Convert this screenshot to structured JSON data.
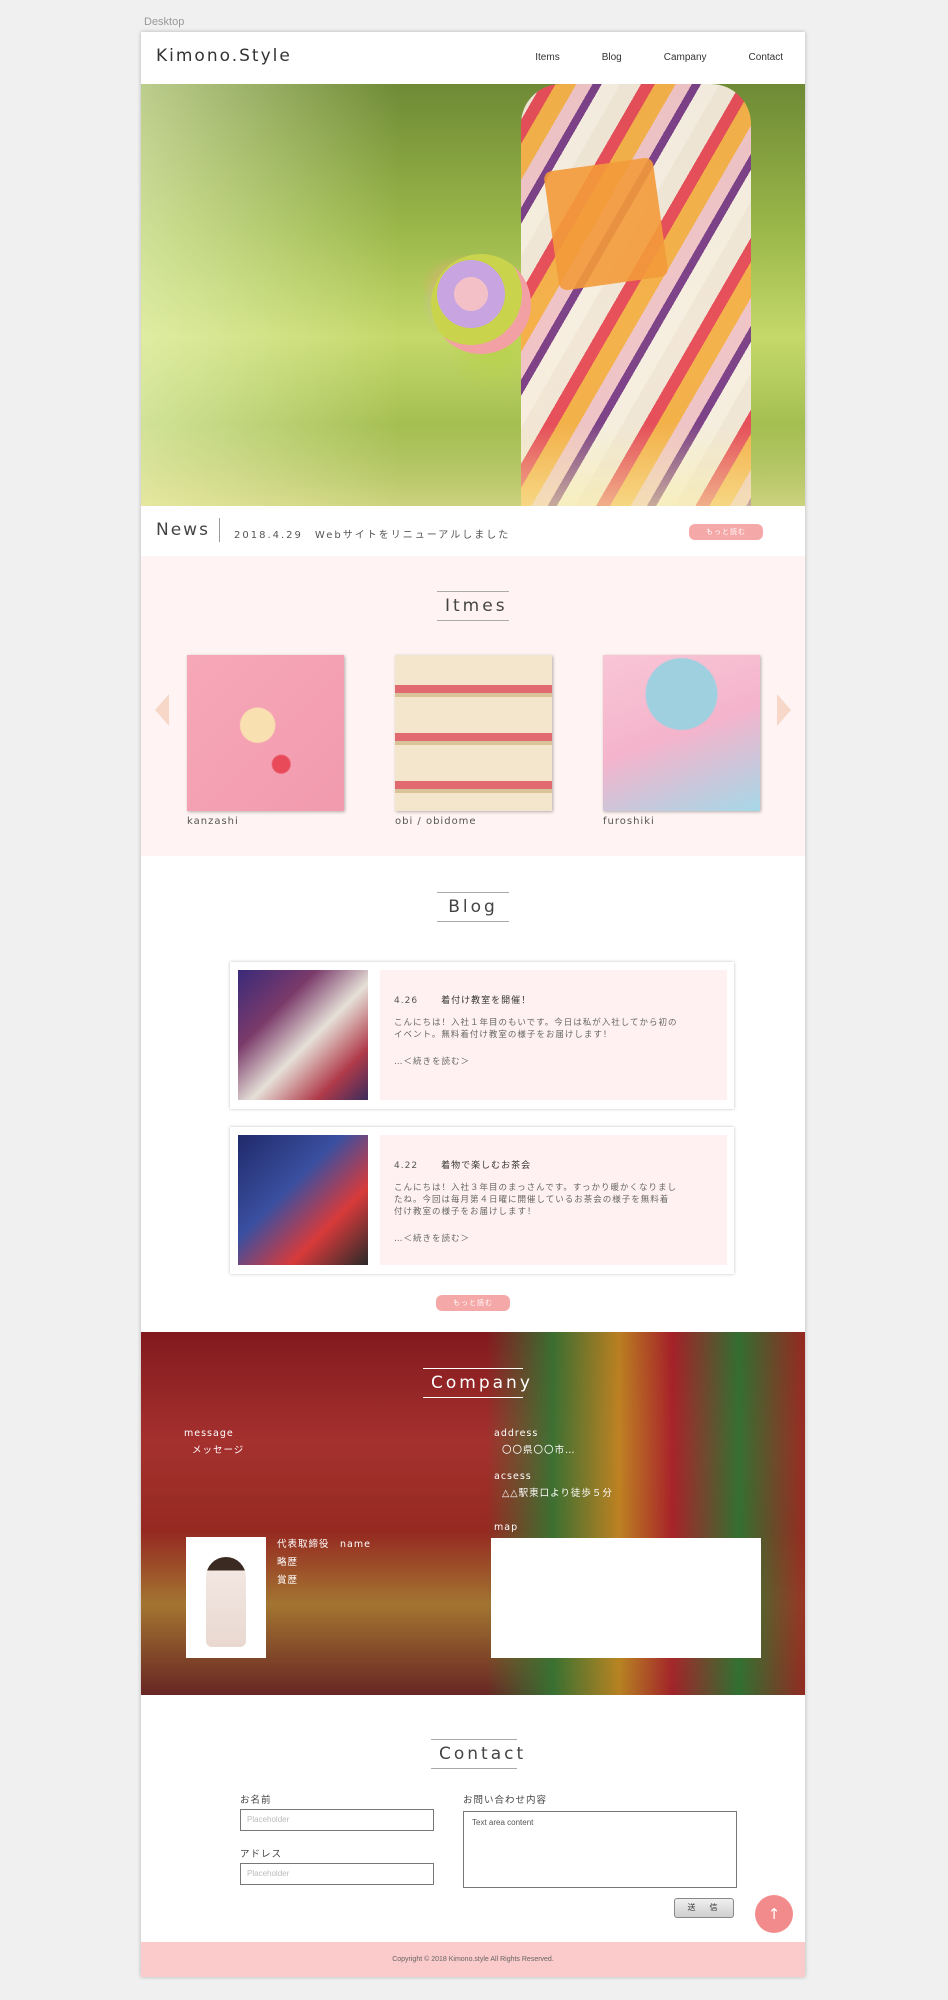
{
  "canvas": {
    "label": "Desktop"
  },
  "header": {
    "logo": "Kimono.Style",
    "nav": [
      "Items",
      "Blog",
      "Campany",
      "Contact"
    ]
  },
  "news": {
    "title": "News",
    "text": "2018.4.29　Webサイトをリニューアルしました",
    "more": "もっと読む"
  },
  "items": {
    "title": "Itmes",
    "list": [
      {
        "label": "kanzashi",
        "image": "kanzashi-photo"
      },
      {
        "label": "obi / obidome",
        "image": "obi-photo"
      },
      {
        "label": "furoshiki",
        "image": "furoshiki-photo"
      }
    ]
  },
  "blog": {
    "title": "Blog",
    "posts": [
      {
        "date": "4.26",
        "heading": "着付け教室を開催！",
        "text_1": "こんにちは！入社１年目のもいです。今日は私が入社してから初の",
        "text_2": "イベント。無料着付け教室の様子をお届けします！",
        "text_3": "",
        "more": "…＜続きを読む＞"
      },
      {
        "date": "4.22",
        "heading": "着物で楽しむお茶会",
        "text_1": "こんにちは！入社３年目のまっさんです。すっかり暖かくなりまし",
        "text_2": "たね。今回は毎月第４日曜に開催しているお茶会の様子を無料着",
        "text_3": "付け教室の様子をお届けします！",
        "more": "…＜続きを読む＞"
      }
    ],
    "more": "もっと読む"
  },
  "company": {
    "title": "Company",
    "message_label": "message",
    "message_value": "メッセージ",
    "address_label": "address",
    "address_value": "〇〇県〇〇市…",
    "access_label": "acsess",
    "access_value": "△△駅東口より徒歩５分",
    "ceo_label": "代表取締役　name",
    "history": "略歴",
    "awards": "賞歴",
    "map_label": "map"
  },
  "contact": {
    "title": "Contact",
    "name_label": "お名前",
    "name_placeholder": "Placeholder",
    "address_label": "アドレス",
    "address_placeholder": "Placeholder",
    "message_label": "お問い合わせ内容",
    "message_value": "Text area content",
    "submit": "送　信",
    "to_top_icon": "up-arrow-icon"
  },
  "footer": {
    "copyright": "Copyright © 2018 Kimono.style All Rights Reserved."
  },
  "colors": {
    "accent_pink": "#f4a9a8",
    "items_bg": "#fff4f3",
    "footer_bg": "#fbcacb",
    "to_top": "#f28c8c"
  }
}
